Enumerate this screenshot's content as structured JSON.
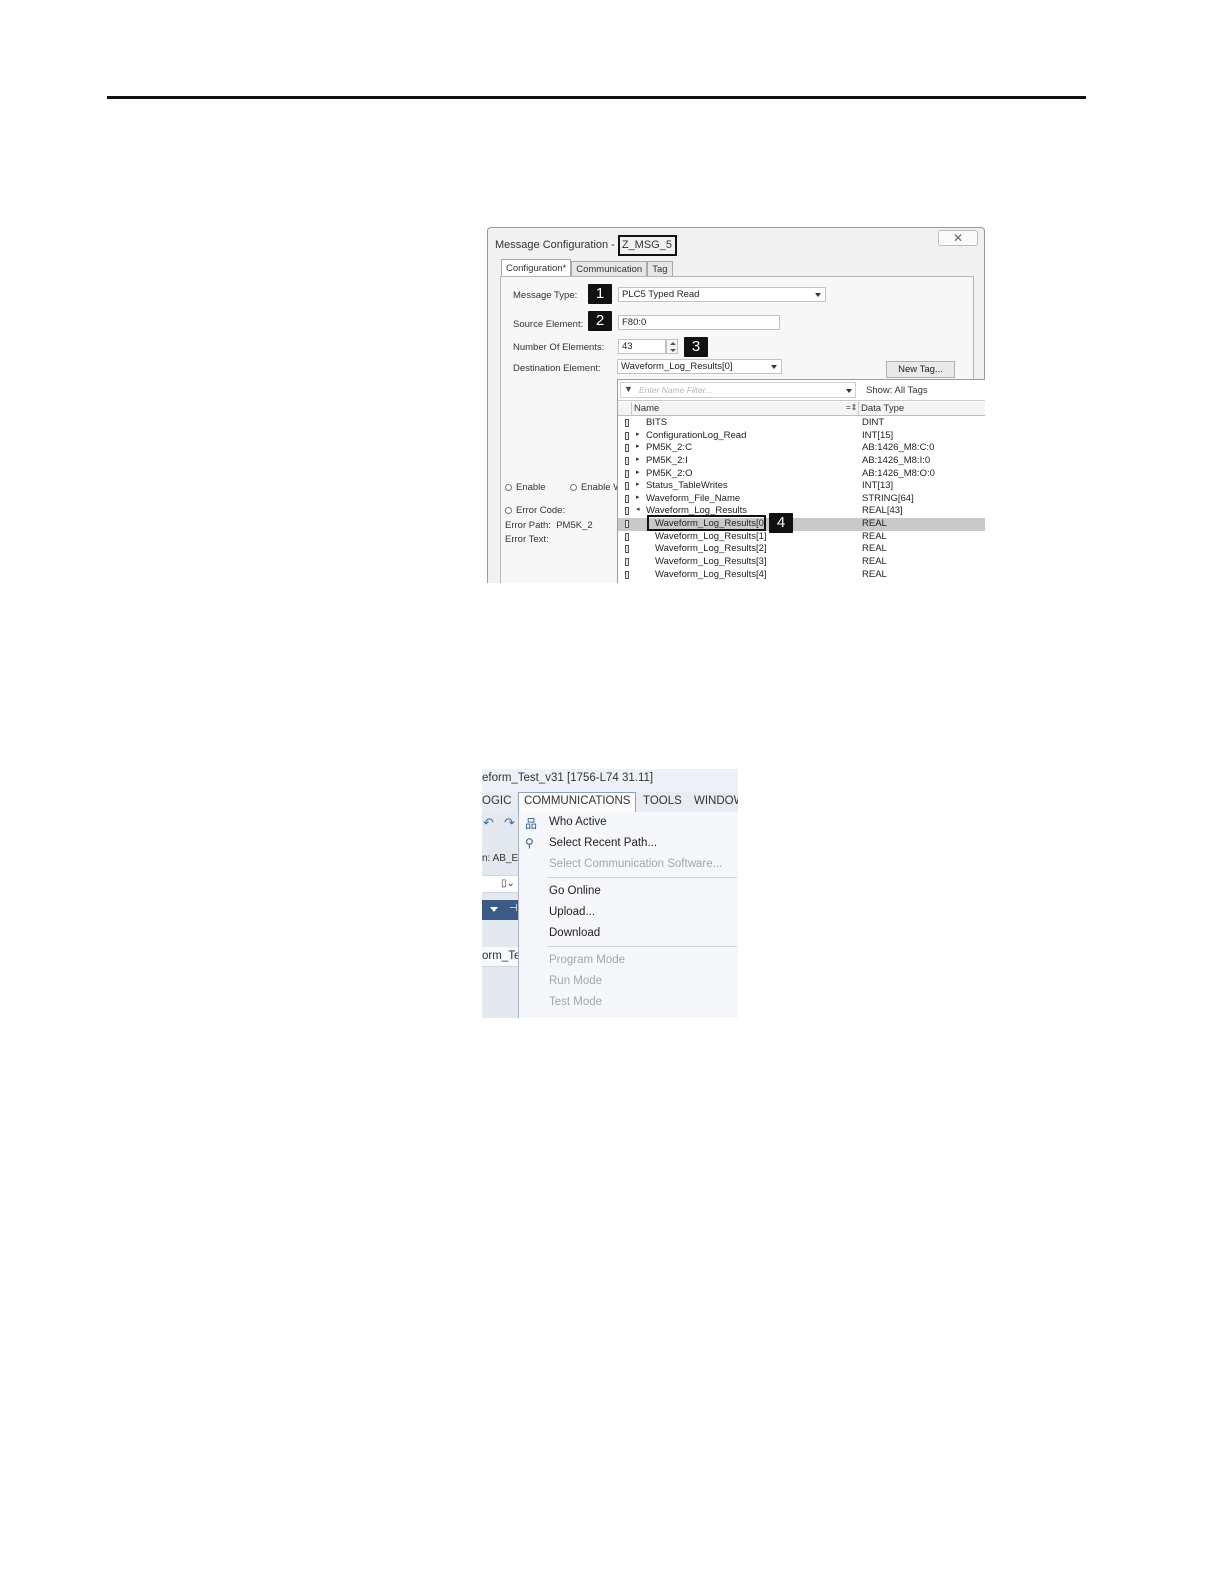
{
  "screenshot1": {
    "title_prefix": "Message Configuration -",
    "title_tag": "Z_MSG_5",
    "close_glyph": "✕",
    "tabs": [
      "Configuration*",
      "Communication",
      "Tag"
    ],
    "message_type_label": "Message Type:",
    "message_type_value": "PLC5 Typed Read",
    "source_element_label": "Source Element:",
    "source_element_value": "F80:0",
    "num_elements_label": "Number Of Elements:",
    "num_elements_value": "43",
    "dest_element_label": "Destination Element:",
    "dest_element_value": "Waveform_Log_Results[0]",
    "new_tag_button": "New Tag...",
    "callouts": [
      "1",
      "2",
      "3",
      "4"
    ],
    "enable_label": "Enable",
    "enable_waiting_label": "Enable W",
    "error_code_label": "Error Code:",
    "error_path_label": "Error Path:",
    "error_path_value": "PM5K_2",
    "error_text_label": "Error Text:",
    "tag_browser": {
      "filter_placeholder": "Enter Name Filter...",
      "show_label": "Show: All Tags",
      "col_name": "Name",
      "col_sort": "=⇕",
      "col_type": "Data Type",
      "rows": [
        {
          "name": "BITS",
          "type": "DINT",
          "expander": ""
        },
        {
          "name": "ConfigurationLog_Read",
          "type": "INT[15]",
          "expander": "▸"
        },
        {
          "name": "PM5K_2:C",
          "type": "AB:1426_M8:C:0",
          "expander": "▸"
        },
        {
          "name": "PM5K_2:I",
          "type": "AB:1426_M8:I:0",
          "expander": "▸"
        },
        {
          "name": "PM5K_2:O",
          "type": "AB:1426_M8:O:0",
          "expander": "▸"
        },
        {
          "name": "Status_TableWrites",
          "type": "INT[13]",
          "expander": "▸"
        },
        {
          "name": "Waveform_File_Name",
          "type": "STRING[64]",
          "expander": "▸"
        },
        {
          "name": "Waveform_Log_Results",
          "type": "REAL[43]",
          "expander": "◂"
        },
        {
          "name": "Waveform_Log_Results[0]",
          "type": "REAL",
          "expander": ""
        },
        {
          "name": "Waveform_Log_Results[1]",
          "type": "REAL",
          "expander": ""
        },
        {
          "name": "Waveform_Log_Results[2]",
          "type": "REAL",
          "expander": ""
        },
        {
          "name": "Waveform_Log_Results[3]",
          "type": "REAL",
          "expander": ""
        },
        {
          "name": "Waveform_Log_Results[4]",
          "type": "REAL",
          "expander": ""
        }
      ]
    }
  },
  "screenshot2": {
    "app_title": "eform_Test_v31 [1756-L74 31.11]",
    "menubar": [
      "OGIC",
      "COMMUNICATIONS",
      "TOOLS",
      "WINDOW"
    ],
    "strip_path_text": "n: AB_ET",
    "strip_tab_text": "orm_Te",
    "menu_items": [
      {
        "label": "Who Active",
        "enabled": true,
        "icon": "network-icon"
      },
      {
        "label": "Select Recent Path...",
        "enabled": true,
        "icon": "path-icon"
      },
      {
        "label": "Select Communication Software...",
        "enabled": false,
        "icon": ""
      },
      {
        "label": "Go Online",
        "enabled": true,
        "icon": ""
      },
      {
        "label": "Upload...",
        "enabled": true,
        "icon": ""
      },
      {
        "label": "Download",
        "enabled": true,
        "icon": ""
      },
      {
        "label": "Program Mode",
        "enabled": false,
        "icon": ""
      },
      {
        "label": "Run Mode",
        "enabled": false,
        "icon": ""
      },
      {
        "label": "Test Mode",
        "enabled": false,
        "icon": ""
      }
    ]
  }
}
